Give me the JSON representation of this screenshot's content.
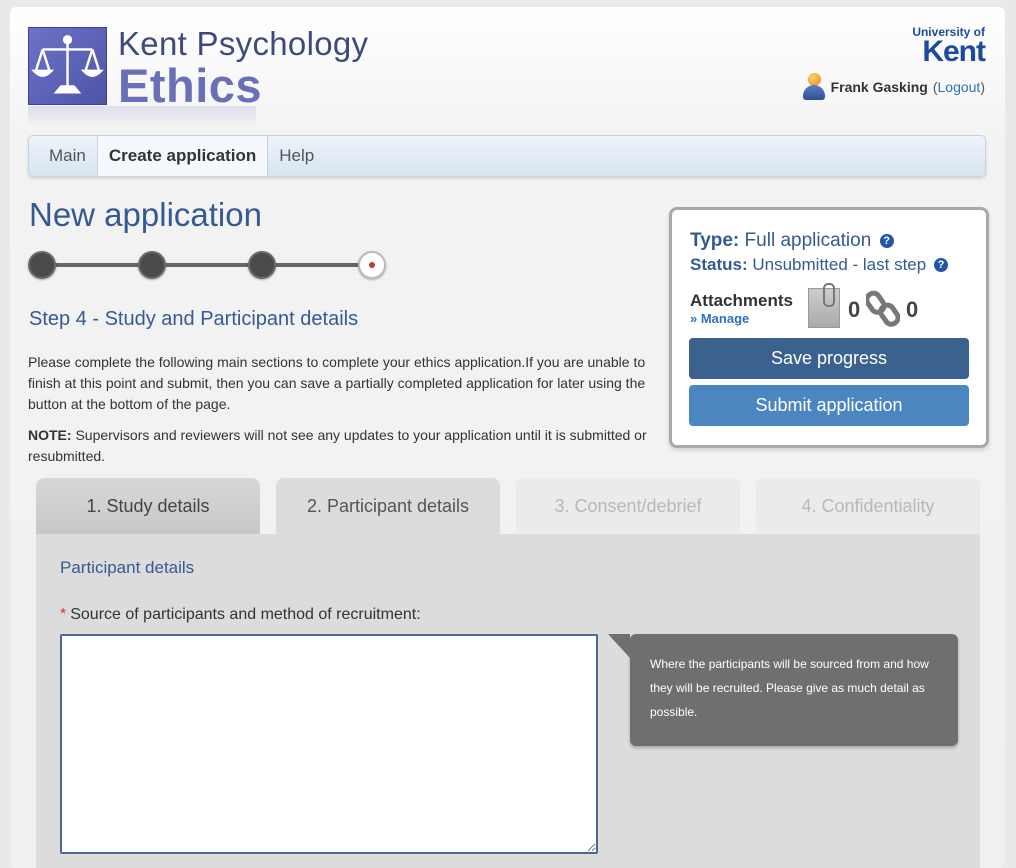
{
  "header": {
    "brand_line1": "Kent Psychology",
    "brand_line2": "Ethics",
    "university_small": "University of",
    "university_big": "Kent",
    "user_name": "Frank Gasking",
    "logout_label": "Logout",
    "logo_icon": "scales-of-justice-icon",
    "user_icon": "user-avatar-icon"
  },
  "nav": {
    "items": [
      {
        "label": "Main"
      },
      {
        "label": "Create application",
        "active": true
      },
      {
        "label": "Help"
      }
    ]
  },
  "page": {
    "title": "New application",
    "stepper": {
      "total_steps": 4,
      "current_step": 4
    },
    "step_heading": "Step 4 - Study and Participant details",
    "intro": "Please complete the following main sections to complete your ethics application.If you are unable to finish at this point and submit, then you can save a partially completed application for later using the button at the bottom of the page.",
    "note_label": "NOTE:",
    "note_text": " Supervisors and reviewers will not see any updates to your application until it is submitted or resubmitted."
  },
  "status_panel": {
    "type_label": "Type:",
    "type_value": "Full application",
    "status_label": "Status:",
    "status_value": "Unsubmitted - last step",
    "attachments_label": "Attachments",
    "manage_label": "» Manage",
    "attachment_count": "0",
    "link_count": "0",
    "save_label": "Save progress",
    "submit_label": "Submit application",
    "colors": {
      "save": "#3b628f",
      "submit": "#4b86c0"
    }
  },
  "tabs": [
    {
      "label": "1. Study details",
      "state": "visited"
    },
    {
      "label": "2. Participant details",
      "state": "active"
    },
    {
      "label": "3. Consent/debrief",
      "state": "disabled"
    },
    {
      "label": "4. Confidentiality",
      "state": "disabled"
    }
  ],
  "participant_section": {
    "heading": "Participant details",
    "required_marker": "*",
    "field_label": "Source of participants and method of recruitment:",
    "field_value": "",
    "tooltip": "Where the participants will be sourced from and how they will be recruited. Please give as much detail as possible."
  }
}
